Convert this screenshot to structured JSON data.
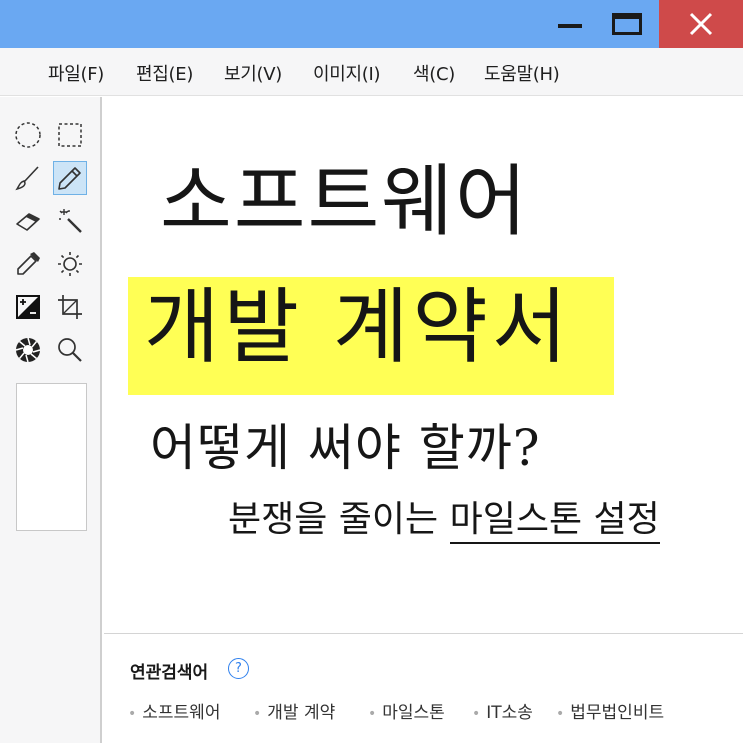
{
  "window": {
    "minimize_icon": "minimize-icon",
    "maximize_icon": "maximize-icon",
    "close_icon": "close-icon",
    "close_symbol": "✕",
    "titlebar_color": "#6aa8f2",
    "close_color": "#cf4a4a"
  },
  "menu": {
    "items": [
      "파일(F)",
      "편집(E)",
      "보기(V)",
      "이미지(I)",
      "색(C)",
      "도움말(H)"
    ]
  },
  "tools": [
    "ellipse-select-icon",
    "rect-select-icon",
    "brush-icon",
    "pencil-icon",
    "eraser-icon",
    "magic-wand-icon",
    "eyedropper-icon",
    "brightness-icon",
    "contrast-icon",
    "crop-icon",
    "aperture-icon",
    "magnifier-icon"
  ],
  "active_tool": "pencil-icon",
  "canvas": {
    "line1": "소프트웨어",
    "line2": "개발 계약서",
    "line3": "어떻게 써야 할까?",
    "line4_prefix": "분쟁을 줄이는 ",
    "line4_underlined": "마일스톤 설정",
    "highlight_color": "#ffff55"
  },
  "related": {
    "title": "연관검색어",
    "help": "?",
    "tags": [
      "소프트웨어",
      "개발 계약",
      "마일스톤",
      "IT소송",
      "법무법인비트"
    ]
  }
}
